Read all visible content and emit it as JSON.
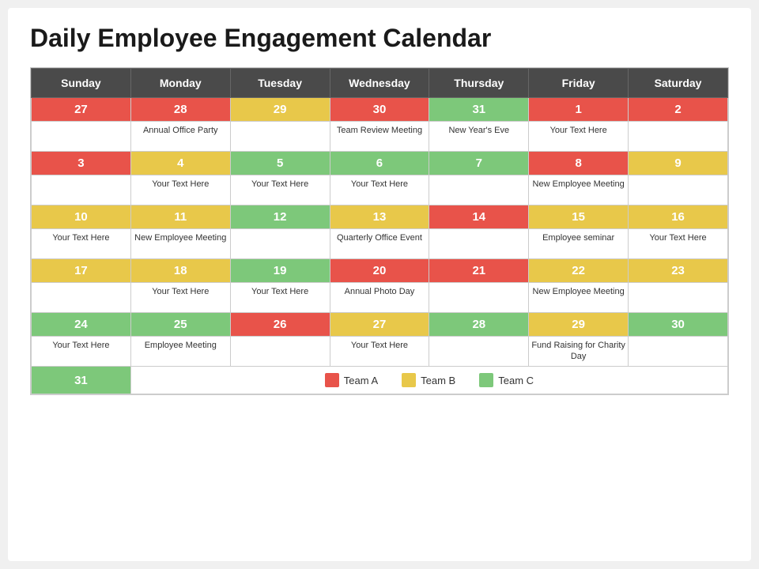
{
  "title": "Daily Employee Engagement Calendar",
  "headers": [
    "Sunday",
    "Monday",
    "Tuesday",
    "Wednesday",
    "Thursday",
    "Friday",
    "Saturday"
  ],
  "weeks": [
    {
      "dates": [
        {
          "num": "27",
          "color": "red"
        },
        {
          "num": "28",
          "color": "red"
        },
        {
          "num": "29",
          "color": "yellow"
        },
        {
          "num": "30",
          "color": "red"
        },
        {
          "num": "31",
          "color": "green"
        },
        {
          "num": "1",
          "color": "red"
        },
        {
          "num": "2",
          "color": "red"
        }
      ],
      "events": [
        "",
        "Annual Office Party",
        "",
        "Team Review Meeting",
        "New Year's Eve",
        "Your Text Here",
        ""
      ]
    },
    {
      "dates": [
        {
          "num": "3",
          "color": "red"
        },
        {
          "num": "4",
          "color": "yellow"
        },
        {
          "num": "5",
          "color": "green"
        },
        {
          "num": "6",
          "color": "green"
        },
        {
          "num": "7",
          "color": "green"
        },
        {
          "num": "8",
          "color": "red"
        },
        {
          "num": "9",
          "color": "yellow"
        }
      ],
      "events": [
        "",
        "Your Text Here",
        "Your Text Here",
        "Your Text Here",
        "",
        "New Employee Meeting",
        ""
      ]
    },
    {
      "dates": [
        {
          "num": "10",
          "color": "yellow"
        },
        {
          "num": "11",
          "color": "yellow"
        },
        {
          "num": "12",
          "color": "green"
        },
        {
          "num": "13",
          "color": "yellow"
        },
        {
          "num": "14",
          "color": "red"
        },
        {
          "num": "15",
          "color": "yellow"
        },
        {
          "num": "16",
          "color": "yellow"
        }
      ],
      "events": [
        "Your Text Here",
        "New Employee Meeting",
        "",
        "Quarterly Office Event",
        "",
        "Employee seminar",
        "Your Text Here"
      ]
    },
    {
      "dates": [
        {
          "num": "17",
          "color": "yellow"
        },
        {
          "num": "18",
          "color": "yellow"
        },
        {
          "num": "19",
          "color": "green"
        },
        {
          "num": "20",
          "color": "red"
        },
        {
          "num": "21",
          "color": "red"
        },
        {
          "num": "22",
          "color": "yellow"
        },
        {
          "num": "23",
          "color": "yellow"
        }
      ],
      "events": [
        "",
        "Your Text Here",
        "Your Text Here",
        "Annual Photo Day",
        "",
        "New Employee Meeting",
        ""
      ]
    },
    {
      "dates": [
        {
          "num": "24",
          "color": "green"
        },
        {
          "num": "25",
          "color": "green"
        },
        {
          "num": "26",
          "color": "red"
        },
        {
          "num": "27",
          "color": "yellow"
        },
        {
          "num": "28",
          "color": "green"
        },
        {
          "num": "29",
          "color": "yellow"
        },
        {
          "num": "30",
          "color": "green"
        }
      ],
      "events": [
        "Your Text Here",
        "Employee Meeting",
        "",
        "Your Text Here",
        "",
        "Fund Raising for Charity Day",
        ""
      ]
    }
  ],
  "last_row": {
    "date": "31",
    "date_color": "green"
  },
  "legend": {
    "team_a": "Team A",
    "team_b": "Team B",
    "team_c": "Team C"
  }
}
